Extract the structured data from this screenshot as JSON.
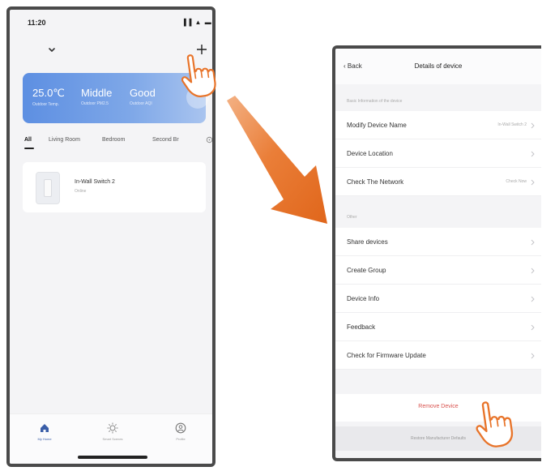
{
  "home": {
    "status_time": "11:20",
    "status_icons": "▐▐ ▲ ▬",
    "weather": [
      {
        "value": "25.0℃",
        "label": "Outdoor Temp."
      },
      {
        "value": "Middle",
        "label": "Outdoor PM2.5"
      },
      {
        "value": "Good",
        "label": "Outdoor AQI"
      }
    ],
    "rooms": [
      "All",
      "Living Room",
      "Bedroom",
      "Second Br"
    ],
    "device": {
      "name": "In-Wall Switch 2",
      "status": "Online"
    },
    "tabs": [
      {
        "label": "My Home",
        "icon": "home-icon"
      },
      {
        "label": "Smart Scenes",
        "icon": "sun-icon"
      },
      {
        "label": "Profile",
        "icon": "profile-icon"
      }
    ]
  },
  "details": {
    "back_label": "Back",
    "title": "Details of device",
    "basic_section": "Basic Information of the device",
    "other_section": "Other",
    "rows_basic": [
      {
        "label": "Modify Device Name",
        "value": "In-Wall Switch 2"
      },
      {
        "label": "Device Location",
        "value": ""
      },
      {
        "label": "Check The Network",
        "value": "Check Now"
      }
    ],
    "rows_other": [
      {
        "label": "Share devices"
      },
      {
        "label": "Create Group"
      },
      {
        "label": "Device Info"
      },
      {
        "label": "Feedback"
      },
      {
        "label": "Check for Firmware Update"
      }
    ],
    "remove_label": "Remove Device",
    "restore_label": "Restore Manufacturer Defaults"
  },
  "colors": {
    "arrow": "#e8742a",
    "weather_start": "#5d8fe2",
    "remove": "#d9534f",
    "tab_active": "#3a5ea8"
  }
}
